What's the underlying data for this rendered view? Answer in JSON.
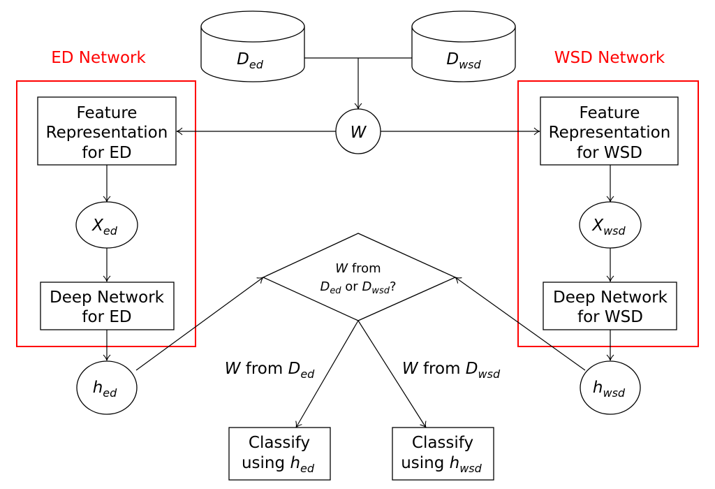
{
  "colors": {
    "network_label": "#ff0000",
    "network_border": "#ff0000",
    "stroke": "#000000"
  },
  "networks": {
    "ed": {
      "title": "ED Network"
    },
    "wsd": {
      "title": "WSD Network"
    }
  },
  "datasets": {
    "ed": {
      "main": "D",
      "sub": "ed"
    },
    "wsd": {
      "main": "D",
      "sub": "wsd"
    }
  },
  "weights": {
    "main": "W"
  },
  "feature": {
    "ed": {
      "line1": "Feature",
      "line2": "Representation",
      "line3": "for ED"
    },
    "wsd": {
      "line1": "Feature",
      "line2": "Representation",
      "line3": "for WSD"
    }
  },
  "x_nodes": {
    "ed": {
      "main": "X",
      "sub": "ed"
    },
    "wsd": {
      "main": "X",
      "sub": "wsd"
    }
  },
  "deep": {
    "ed": {
      "line1": "Deep Network",
      "line2": "for ED"
    },
    "wsd": {
      "line1": "Deep Network",
      "line2": "for WSD"
    }
  },
  "h_nodes": {
    "ed": {
      "main": "h",
      "sub": "ed"
    },
    "wsd": {
      "main": "h",
      "sub": "wsd"
    }
  },
  "decision": {
    "w": "W",
    "from": "from",
    "d1": "D",
    "d1_sub": "ed",
    "or": "or",
    "d2": "D",
    "d2_sub": "wsd",
    "q": "?"
  },
  "branches": {
    "left": {
      "w": "W",
      "from": "from",
      "d": "D",
      "sub": "ed"
    },
    "right": {
      "w": "W",
      "from": "from",
      "d": "D",
      "sub": "wsd"
    }
  },
  "classify": {
    "ed": {
      "line1": "Classify",
      "using": "using",
      "h": "h",
      "sub": "ed"
    },
    "wsd": {
      "line1": "Classify",
      "using": "using",
      "h": "h",
      "sub": "wsd"
    }
  }
}
